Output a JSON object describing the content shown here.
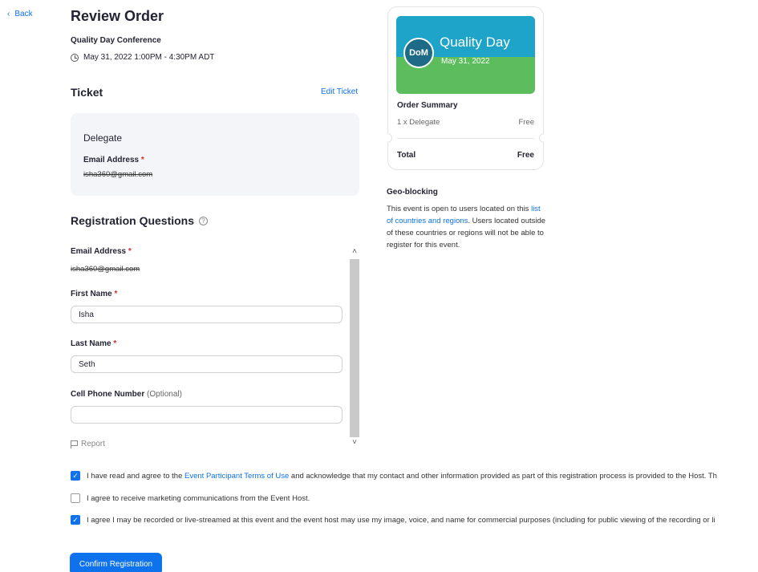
{
  "nav": {
    "back_label": "Back"
  },
  "header": {
    "title": "Review Order",
    "event_name": "Quality Day Conference",
    "event_time": "May 31, 2022 1:00PM - 4:30PM ADT"
  },
  "ticket": {
    "heading": "Ticket",
    "edit_label": "Edit Ticket",
    "type": "Delegate",
    "email_label": "Email Address",
    "email_value": "isha360@gmail.com"
  },
  "registration": {
    "heading": "Registration Questions",
    "email_label": "Email Address",
    "email_value": "isha360@gmail.com",
    "first_name_label": "First Name",
    "first_name_value": "Isha",
    "last_name_label": "Last Name",
    "last_name_value": "Seth",
    "phone_label": "Cell Phone Number",
    "phone_optional": "(Optional)",
    "phone_value": "",
    "report_label": "Report"
  },
  "summary": {
    "banner_title": "Quality Day",
    "banner_date": "May 31, 2022",
    "logo_text": "DoM",
    "heading": "Order Summary",
    "line_item": "1 x Delegate",
    "line_price": "Free",
    "total_label": "Total",
    "total_value": "Free"
  },
  "geo": {
    "heading": "Geo-blocking",
    "text_before": "This event is open to users located on this ",
    "link": "list of countries and regions",
    "text_after": ". Users located outside of these countries or regions will not be able to register for this event."
  },
  "consents": [
    {
      "checked": true,
      "before": "I have read and agree to the ",
      "link": "Event Participant Terms of Use",
      "after": " and acknowledge that my contact and other information provided as part of this registration process is provided to the Host. Th"
    },
    {
      "checked": false,
      "text": "I agree to receive marketing communications from the Event Host."
    },
    {
      "checked": true,
      "text": "I agree I may be recorded or live-streamed at this event and the event host may use my image, voice, and name for commercial purposes (including for public viewing of the recording or li"
    }
  ],
  "actions": {
    "confirm_label": "Confirm Registration"
  },
  "colors": {
    "accent": "#0e72ed",
    "required": "#e02828",
    "banner_top": "#1ea3c9",
    "banner_bottom": "#5cbd5c"
  }
}
